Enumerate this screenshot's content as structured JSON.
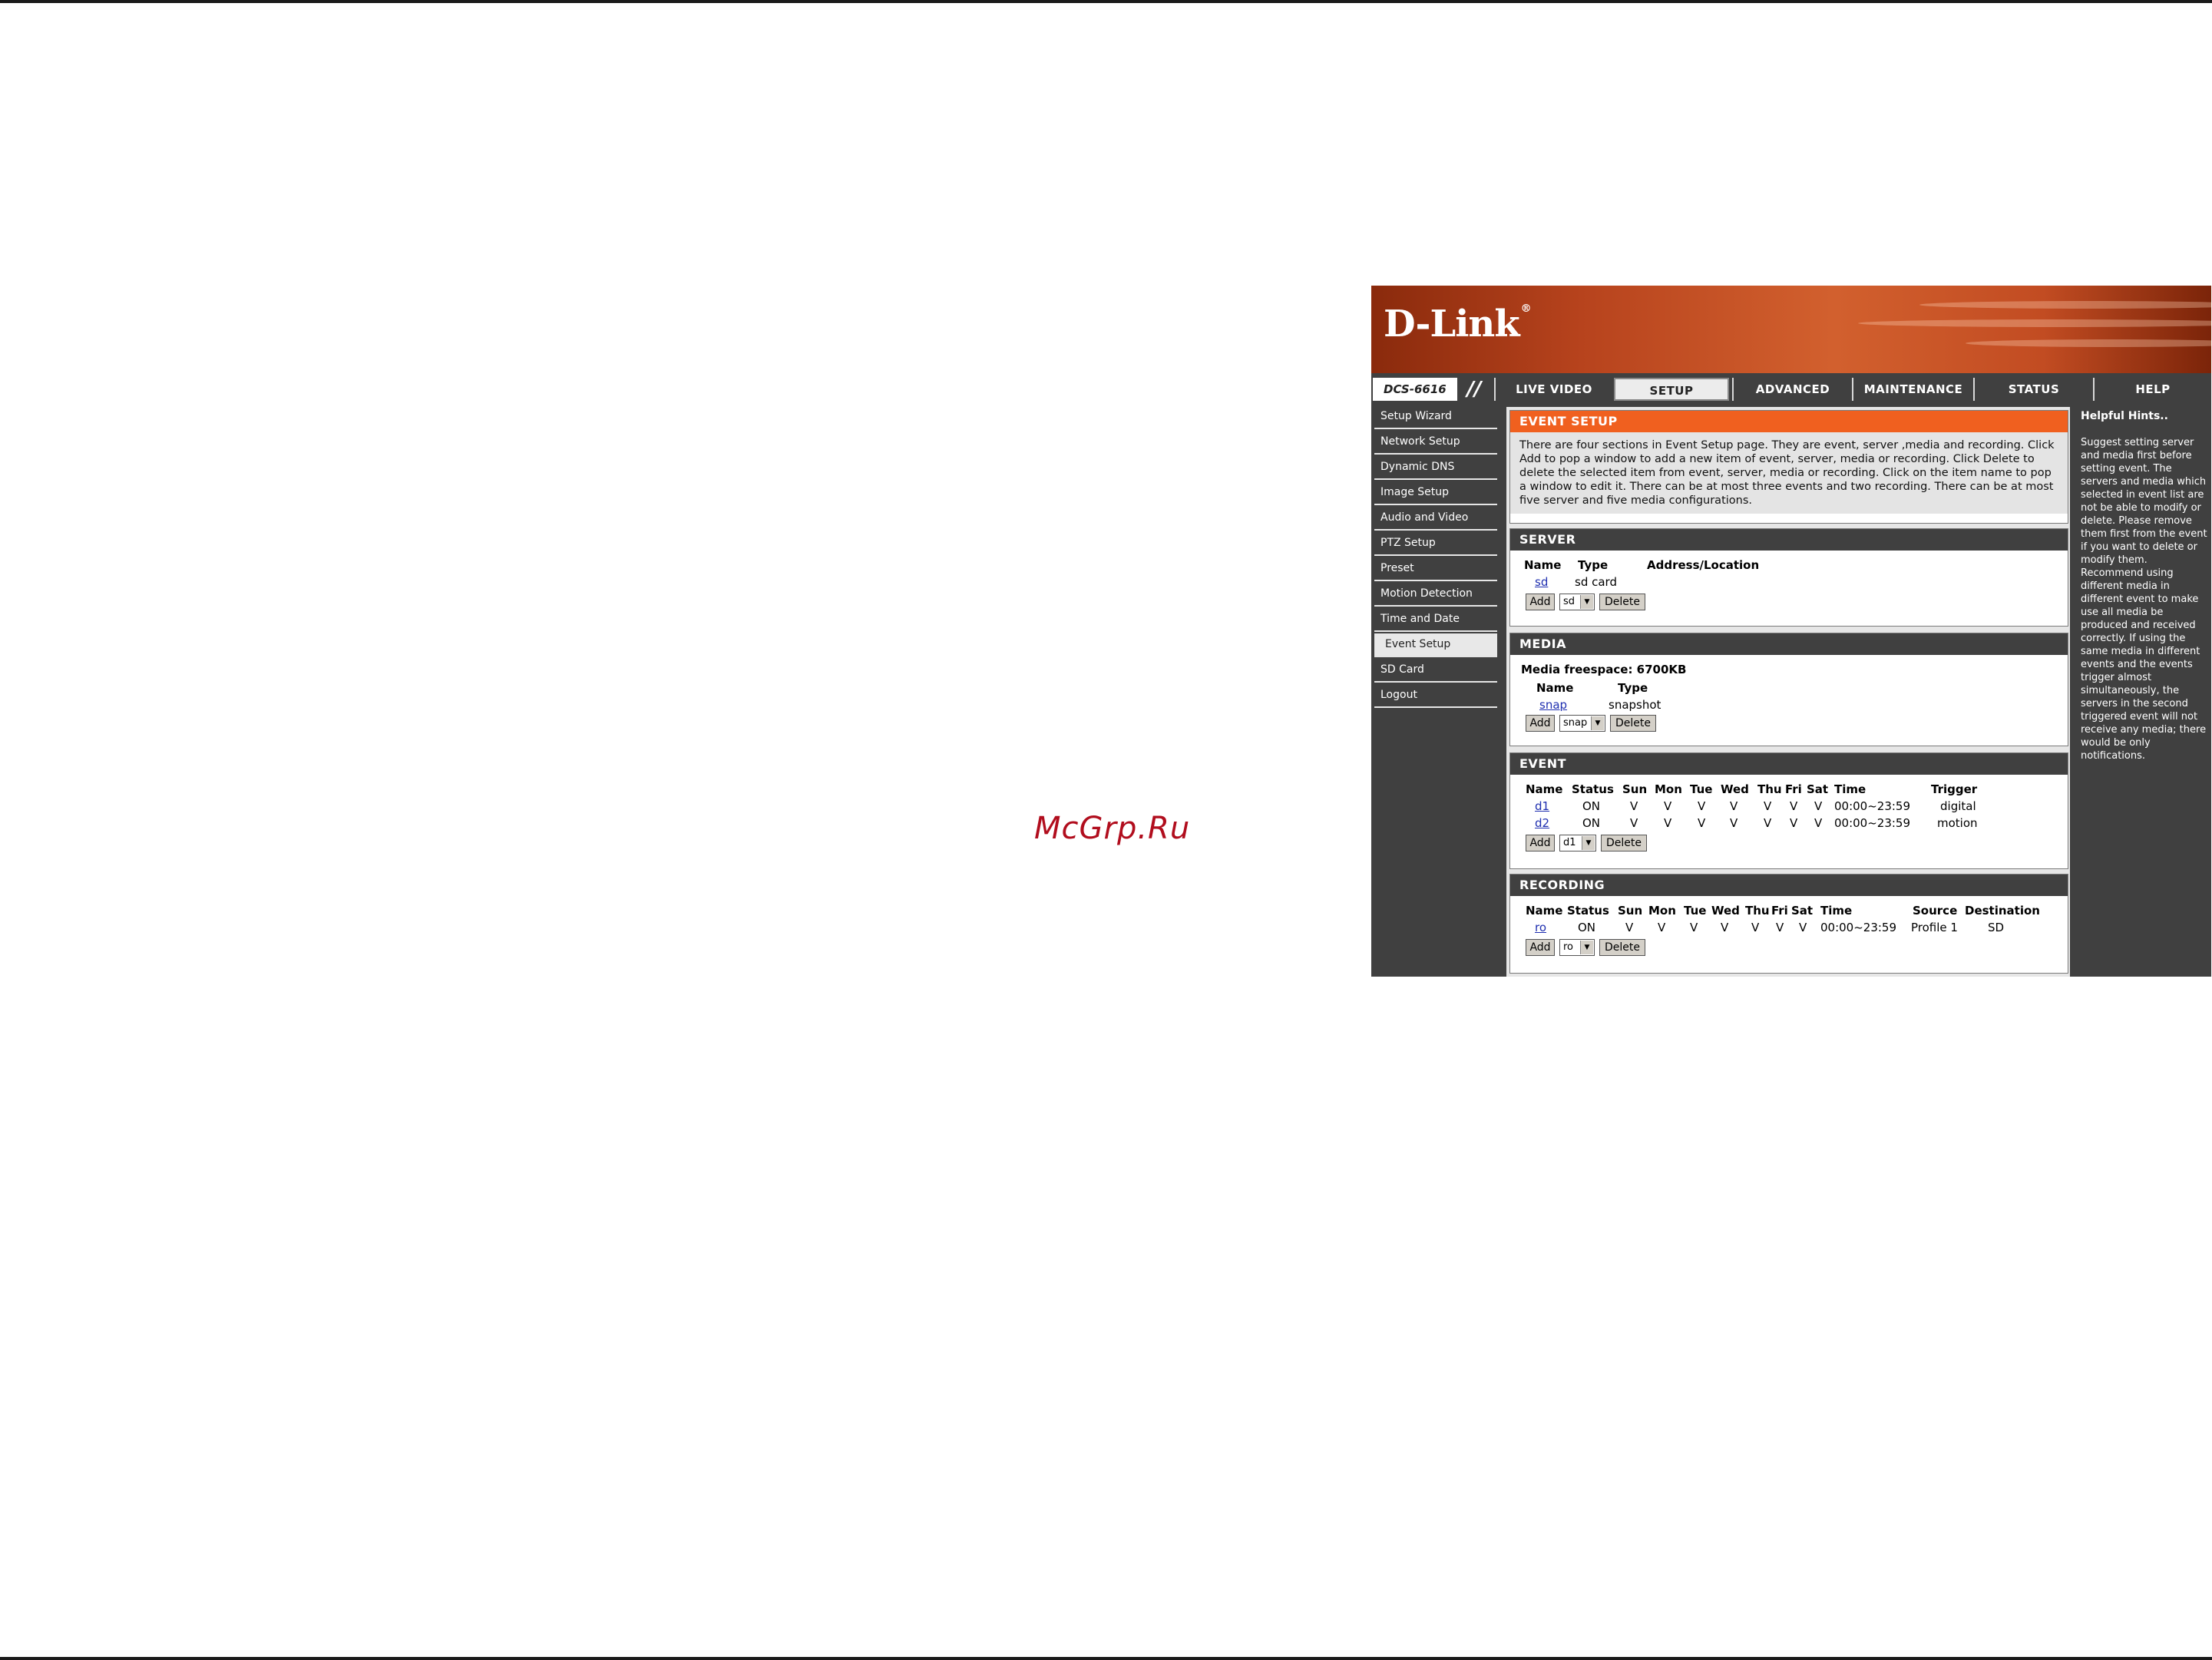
{
  "watermark": "McGrp.Ru",
  "brand": {
    "logo": "D-Link",
    "reg": "®",
    "model": "DCS-6616",
    "slashes": "//"
  },
  "tabs": [
    "LIVE VIDEO",
    "SETUP",
    "ADVANCED",
    "MAINTENANCE",
    "STATUS",
    "HELP"
  ],
  "active_tab": "SETUP",
  "sidebar": [
    "Setup Wizard",
    "Network Setup",
    "Dynamic DNS",
    "Image Setup",
    "Audio and Video",
    "PTZ Setup",
    "Preset",
    "Motion Detection",
    "Time and Date",
    "Event Setup",
    "SD Card",
    "Logout"
  ],
  "active_sidebar": "Event Setup",
  "event_setup": {
    "title": "EVENT SETUP",
    "description": "There are four sections in Event Setup page. They are event, server ,media and recording. Click Add to pop a window to add a new item of event, server, media or recording. Click Delete to delete the selected item from event, server, media or recording. Click on the item name to pop a window to edit it. There can be at most three events and two recording. There can be at most five server and five media configurations."
  },
  "server": {
    "title": "SERVER",
    "headers": {
      "name": "Name",
      "type": "Type",
      "address": "Address/Location"
    },
    "row": {
      "name": "sd",
      "type": "sd card"
    },
    "add": "Add",
    "select": "sd",
    "delete": "Delete"
  },
  "media": {
    "title": "MEDIA",
    "freespace": "Media freespace: 6700KB",
    "headers": {
      "name": "Name",
      "type": "Type"
    },
    "row": {
      "name": "snap",
      "type": "snapshot"
    },
    "add": "Add",
    "select": "snap",
    "delete": "Delete"
  },
  "event": {
    "title": "EVENT",
    "headers": {
      "name": "Name",
      "status": "Status",
      "sun": "Sun",
      "mon": "Mon",
      "tue": "Tue",
      "wed": "Wed",
      "thu": "Thu",
      "fri": "Fri",
      "sat": "Sat",
      "time": "Time",
      "trigger": "Trigger"
    },
    "rows": [
      {
        "name": "d1",
        "status": "ON",
        "sun": "V",
        "mon": "V",
        "tue": "V",
        "wed": "V",
        "thu": "V",
        "fri": "V",
        "sat": "V",
        "time": "00:00~23:59",
        "trigger": "digital"
      },
      {
        "name": "d2",
        "status": "ON",
        "sun": "V",
        "mon": "V",
        "tue": "V",
        "wed": "V",
        "thu": "V",
        "fri": "V",
        "sat": "V",
        "time": "00:00~23:59",
        "trigger": "motion"
      }
    ],
    "add": "Add",
    "select": "d1",
    "delete": "Delete"
  },
  "recording": {
    "title": "RECORDING",
    "headers": {
      "name": "Name",
      "status": "Status",
      "sun": "Sun",
      "mon": "Mon",
      "tue": "Tue",
      "wed": "Wed",
      "thu": "Thu",
      "fri": "Fri",
      "sat": "Sat",
      "time": "Time",
      "source": "Source",
      "destination": "Destination"
    },
    "row": {
      "name": "ro",
      "status": "ON",
      "sun": "V",
      "mon": "V",
      "tue": "V",
      "wed": "V",
      "thu": "V",
      "fri": "V",
      "sat": "V",
      "time": "00:00~23:59",
      "source": "Profile 1",
      "destination": "SD"
    },
    "add": "Add",
    "select": "ro",
    "delete": "Delete"
  },
  "hints": {
    "title": "Helpful Hints..",
    "text": "Suggest setting server and media first before setting event. The servers and media which selected in event list are not be able to modify or delete. Please remove them first from the event if you want to delete or modify them. Recommend using different media in different event to make use all media be produced and received correctly. If using the same media in different events and the events trigger almost simultaneously, the servers in the second triggered event will not receive any media; there would be only notifications."
  },
  "colors": {
    "brand_orange": "#f0601f",
    "panel_dark": "#404040",
    "link": "#1f2fb0",
    "watermark": "#b10d1d"
  }
}
